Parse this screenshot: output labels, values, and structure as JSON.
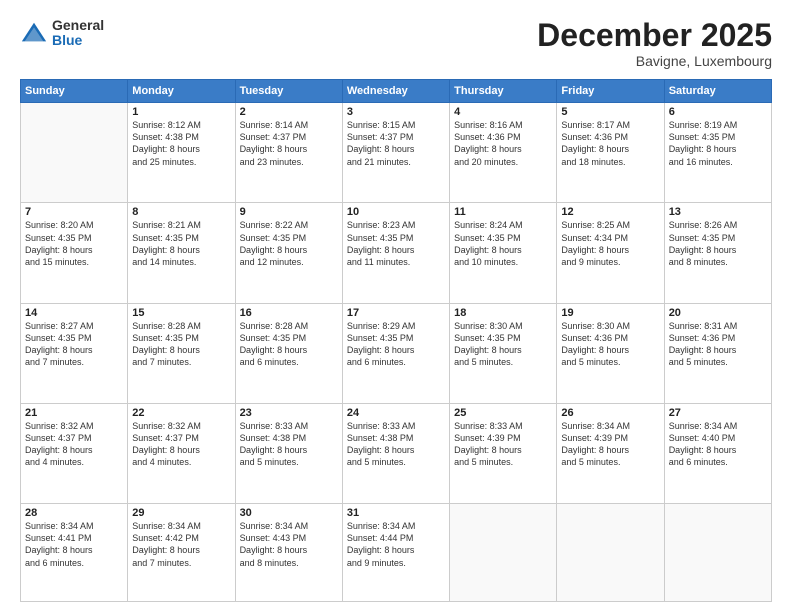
{
  "logo": {
    "general": "General",
    "blue": "Blue"
  },
  "header": {
    "month": "December 2025",
    "location": "Bavigne, Luxembourg"
  },
  "days_of_week": [
    "Sunday",
    "Monday",
    "Tuesday",
    "Wednesday",
    "Thursday",
    "Friday",
    "Saturday"
  ],
  "weeks": [
    [
      {
        "day": "",
        "info": ""
      },
      {
        "day": "1",
        "info": "Sunrise: 8:12 AM\nSunset: 4:38 PM\nDaylight: 8 hours\nand 25 minutes."
      },
      {
        "day": "2",
        "info": "Sunrise: 8:14 AM\nSunset: 4:37 PM\nDaylight: 8 hours\nand 23 minutes."
      },
      {
        "day": "3",
        "info": "Sunrise: 8:15 AM\nSunset: 4:37 PM\nDaylight: 8 hours\nand 21 minutes."
      },
      {
        "day": "4",
        "info": "Sunrise: 8:16 AM\nSunset: 4:36 PM\nDaylight: 8 hours\nand 20 minutes."
      },
      {
        "day": "5",
        "info": "Sunrise: 8:17 AM\nSunset: 4:36 PM\nDaylight: 8 hours\nand 18 minutes."
      },
      {
        "day": "6",
        "info": "Sunrise: 8:19 AM\nSunset: 4:35 PM\nDaylight: 8 hours\nand 16 minutes."
      }
    ],
    [
      {
        "day": "7",
        "info": "Sunrise: 8:20 AM\nSunset: 4:35 PM\nDaylight: 8 hours\nand 15 minutes."
      },
      {
        "day": "8",
        "info": "Sunrise: 8:21 AM\nSunset: 4:35 PM\nDaylight: 8 hours\nand 14 minutes."
      },
      {
        "day": "9",
        "info": "Sunrise: 8:22 AM\nSunset: 4:35 PM\nDaylight: 8 hours\nand 12 minutes."
      },
      {
        "day": "10",
        "info": "Sunrise: 8:23 AM\nSunset: 4:35 PM\nDaylight: 8 hours\nand 11 minutes."
      },
      {
        "day": "11",
        "info": "Sunrise: 8:24 AM\nSunset: 4:35 PM\nDaylight: 8 hours\nand 10 minutes."
      },
      {
        "day": "12",
        "info": "Sunrise: 8:25 AM\nSunset: 4:34 PM\nDaylight: 8 hours\nand 9 minutes."
      },
      {
        "day": "13",
        "info": "Sunrise: 8:26 AM\nSunset: 4:35 PM\nDaylight: 8 hours\nand 8 minutes."
      }
    ],
    [
      {
        "day": "14",
        "info": "Sunrise: 8:27 AM\nSunset: 4:35 PM\nDaylight: 8 hours\nand 7 minutes."
      },
      {
        "day": "15",
        "info": "Sunrise: 8:28 AM\nSunset: 4:35 PM\nDaylight: 8 hours\nand 7 minutes."
      },
      {
        "day": "16",
        "info": "Sunrise: 8:28 AM\nSunset: 4:35 PM\nDaylight: 8 hours\nand 6 minutes."
      },
      {
        "day": "17",
        "info": "Sunrise: 8:29 AM\nSunset: 4:35 PM\nDaylight: 8 hours\nand 6 minutes."
      },
      {
        "day": "18",
        "info": "Sunrise: 8:30 AM\nSunset: 4:35 PM\nDaylight: 8 hours\nand 5 minutes."
      },
      {
        "day": "19",
        "info": "Sunrise: 8:30 AM\nSunset: 4:36 PM\nDaylight: 8 hours\nand 5 minutes."
      },
      {
        "day": "20",
        "info": "Sunrise: 8:31 AM\nSunset: 4:36 PM\nDaylight: 8 hours\nand 5 minutes."
      }
    ],
    [
      {
        "day": "21",
        "info": "Sunrise: 8:32 AM\nSunset: 4:37 PM\nDaylight: 8 hours\nand 4 minutes."
      },
      {
        "day": "22",
        "info": "Sunrise: 8:32 AM\nSunset: 4:37 PM\nDaylight: 8 hours\nand 4 minutes."
      },
      {
        "day": "23",
        "info": "Sunrise: 8:33 AM\nSunset: 4:38 PM\nDaylight: 8 hours\nand 5 minutes."
      },
      {
        "day": "24",
        "info": "Sunrise: 8:33 AM\nSunset: 4:38 PM\nDaylight: 8 hours\nand 5 minutes."
      },
      {
        "day": "25",
        "info": "Sunrise: 8:33 AM\nSunset: 4:39 PM\nDaylight: 8 hours\nand 5 minutes."
      },
      {
        "day": "26",
        "info": "Sunrise: 8:34 AM\nSunset: 4:39 PM\nDaylight: 8 hours\nand 5 minutes."
      },
      {
        "day": "27",
        "info": "Sunrise: 8:34 AM\nSunset: 4:40 PM\nDaylight: 8 hours\nand 6 minutes."
      }
    ],
    [
      {
        "day": "28",
        "info": "Sunrise: 8:34 AM\nSunset: 4:41 PM\nDaylight: 8 hours\nand 6 minutes."
      },
      {
        "day": "29",
        "info": "Sunrise: 8:34 AM\nSunset: 4:42 PM\nDaylight: 8 hours\nand 7 minutes."
      },
      {
        "day": "30",
        "info": "Sunrise: 8:34 AM\nSunset: 4:43 PM\nDaylight: 8 hours\nand 8 minutes."
      },
      {
        "day": "31",
        "info": "Sunrise: 8:34 AM\nSunset: 4:44 PM\nDaylight: 8 hours\nand 9 minutes."
      },
      {
        "day": "",
        "info": ""
      },
      {
        "day": "",
        "info": ""
      },
      {
        "day": "",
        "info": ""
      }
    ]
  ]
}
